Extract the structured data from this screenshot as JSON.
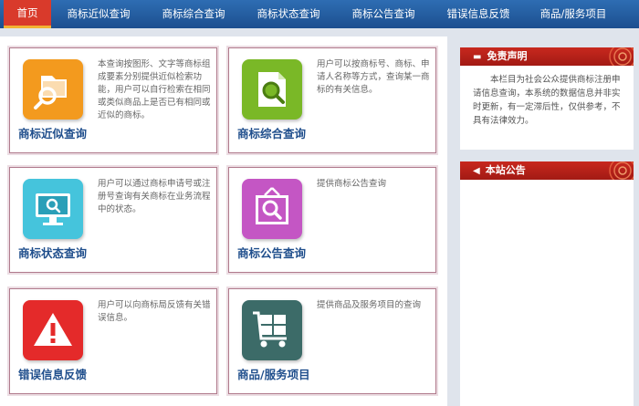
{
  "nav": {
    "items": [
      {
        "label": "首页",
        "active": true
      },
      {
        "label": "商标近似查询"
      },
      {
        "label": "商标综合查询"
      },
      {
        "label": "商标状态查询"
      },
      {
        "label": "商标公告查询"
      },
      {
        "label": "错误信息反馈"
      },
      {
        "label": "商品/服务项目"
      }
    ]
  },
  "tiles": [
    {
      "title": "商标近似查询",
      "desc": "本查询按图形、文字等商标组成要素分别提供近似检索功能，用户可以自行检索在相同或类似商品上是否已有相同或近似的商标。",
      "icon": "folder-search-icon",
      "color": "#f39a1e"
    },
    {
      "title": "商标综合查询",
      "desc": "用户可以按商标号、商标、申请人名称等方式，查询某一商标的有关信息。",
      "icon": "document-search-icon",
      "color": "#7ab827"
    },
    {
      "title": "商标状态查询",
      "desc": "用户可以通过商标申请号或注册号查询有关商标在业务流程中的状态。",
      "icon": "monitor-search-icon",
      "color": "#45c4dc"
    },
    {
      "title": "商标公告查询",
      "desc": "提供商标公告查询",
      "icon": "board-search-icon",
      "color": "#c456c4"
    },
    {
      "title": "错误信息反馈",
      "desc": "用户可以向商标局反馈有关错误信息。",
      "icon": "warning-icon",
      "color": "#e42a2a"
    },
    {
      "title": "商品/服务项目",
      "desc": "提供商品及服务项目的查询",
      "icon": "cart-icon",
      "color": "#3c6b68"
    }
  ],
  "side": {
    "disclaimer_title": "免责声明",
    "disclaimer_text": "本栏目为社会公众提供商标注册申请信息查询，本系统的数据信息并非实时更新，有一定滞后性，仅供参考，不具有法律效力。",
    "notice_title": "本站公告"
  }
}
